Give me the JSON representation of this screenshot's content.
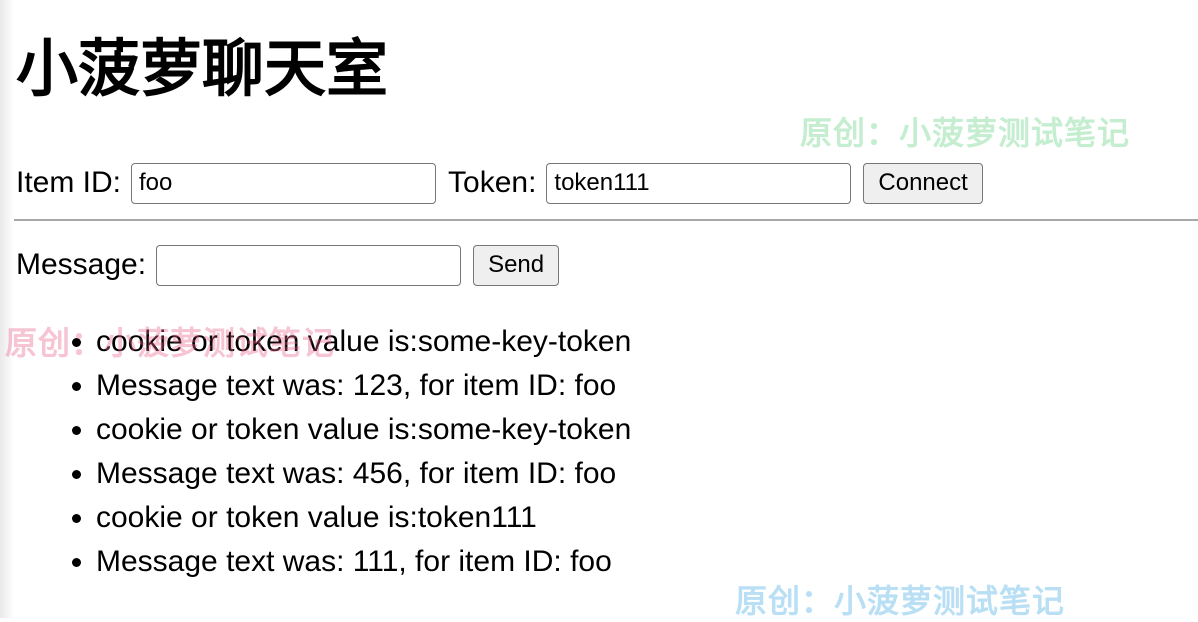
{
  "page": {
    "title": "小菠萝聊天室"
  },
  "connect_form": {
    "item_id_label": "Item ID:",
    "item_id_value": "foo",
    "token_label": "Token:",
    "token_value": "token111",
    "connect_label": "Connect"
  },
  "message_form": {
    "message_label": "Message:",
    "message_value": "",
    "send_label": "Send"
  },
  "messages": [
    "cookie or token value is:some-key-token",
    "Message text was: 123, for item ID: foo",
    "cookie or token value is:some-key-token",
    "Message text was: 456, for item ID: foo",
    "cookie or token value is:token111",
    "Message text was: 111, for item ID: foo"
  ],
  "watermarks": [
    "原创：小菠萝测试笔记",
    "原创：小菠萝测试笔记",
    "原创：小菠萝测试笔记"
  ],
  "colors": {
    "watermark_green": "#64d282",
    "watermark_pink": "#eb648c",
    "watermark_blue": "#46aae6",
    "button_bg": "#efefef",
    "divider": "#a8a8a8"
  }
}
